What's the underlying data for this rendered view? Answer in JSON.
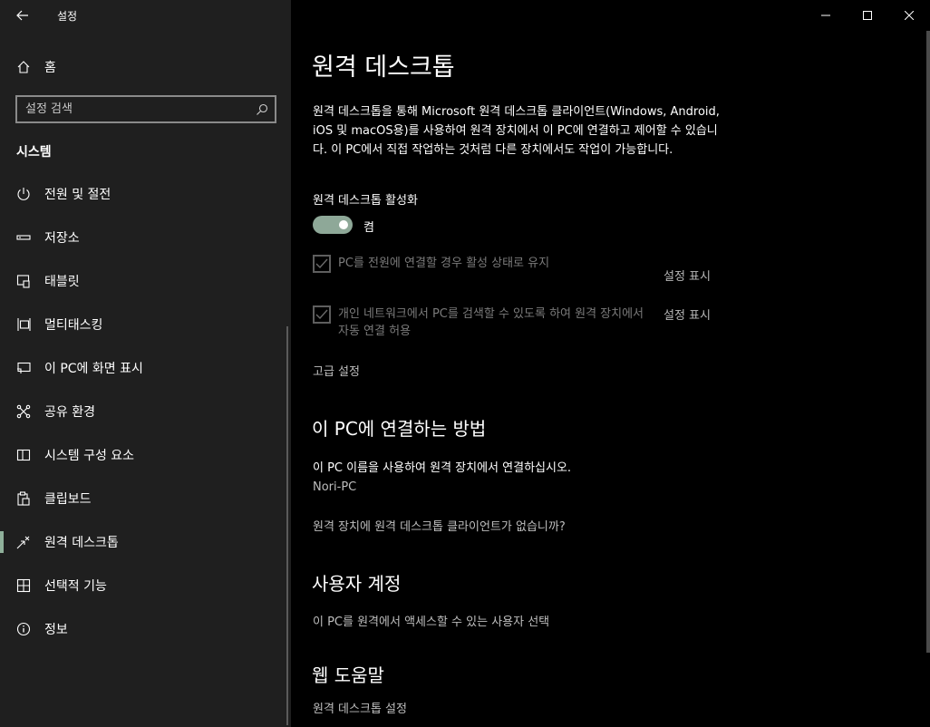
{
  "app": {
    "title": "설정"
  },
  "sidebar": {
    "home_label": "홈",
    "search_placeholder": "설정 검색",
    "section_title": "시스템",
    "items": [
      {
        "label": "전원 및 절전",
        "icon": "power-icon"
      },
      {
        "label": "저장소",
        "icon": "storage-icon"
      },
      {
        "label": "태블릿",
        "icon": "tablet-icon"
      },
      {
        "label": "멀티태스킹",
        "icon": "multitasking-icon"
      },
      {
        "label": "이 PC에 화면 표시",
        "icon": "project-icon"
      },
      {
        "label": "공유 환경",
        "icon": "shared-experiences-icon"
      },
      {
        "label": "시스템 구성 요소",
        "icon": "system-components-icon"
      },
      {
        "label": "클립보드",
        "icon": "clipboard-icon"
      },
      {
        "label": "원격 데스크톱",
        "icon": "remote-desktop-icon",
        "active": true
      },
      {
        "label": "선택적 기능",
        "icon": "optional-features-icon"
      },
      {
        "label": "정보",
        "icon": "info-icon"
      }
    ]
  },
  "main": {
    "title": "원격 데스크톱",
    "description": "원격 데스크톱을 통해 Microsoft 원격 데스크톱 클라이언트(Windows, Android, iOS 및 macOS용)를 사용하여 원격 장치에서 이 PC에 연결하고 제어할 수 있습니다. 이 PC에서 직접 작업하는 것처럼 다른 장치에서도 작업이 가능합니다.",
    "toggle_label": "원격 데스크톱 활성화",
    "toggle_state": "켬",
    "option1": "PC를 전원에 연결할 경우 활성 상태로 유지",
    "option2": "개인 네트워크에서 PC를 검색할 수 있도록 하여 원격 장치에서 자동 연결 허용",
    "show_settings": "설정 표시",
    "advanced": "고급 설정",
    "connect_heading": "이 PC에 연결하는 방법",
    "connect_text": "이 PC 이름을 사용하여 원격 장치에서 연결하십시오.",
    "pc_name": "Nori-PC",
    "no_client_link": "원격 장치에 원격 데스크톱 클라이언트가 없습니까?",
    "accounts_heading": "사용자 계정",
    "accounts_link": "이 PC를 원격에서 액세스할 수 있는 사용자 선택",
    "web_help_heading": "웹 도움말",
    "web_help_link": "원격 데스크톱 설정"
  }
}
